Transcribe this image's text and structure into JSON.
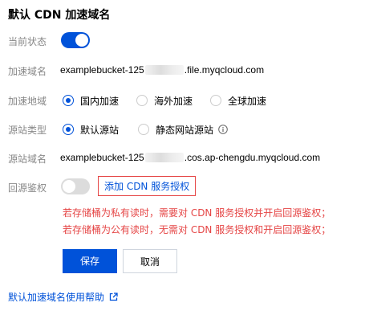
{
  "title": "默认 CDN 加速域名",
  "current_status": {
    "label": "当前状态",
    "enabled": true
  },
  "domain": {
    "label": "加速域名",
    "prefix": "examplebucket-125",
    "suffix": ".file.myqcloud.com"
  },
  "region": {
    "label": "加速地域",
    "options": [
      "国内加速",
      "海外加速",
      "全球加速"
    ],
    "selected": "国内加速"
  },
  "origin_type": {
    "label": "源站类型",
    "options": [
      "默认源站",
      "静态网站源站"
    ],
    "selected": "默认源站"
  },
  "origin_domain": {
    "label": "源站域名",
    "prefix": "examplebucket-125",
    "suffix": ".cos.ap-chengdu.myqcloud.com"
  },
  "back_to_origin_auth": {
    "label": "回源鉴权",
    "enabled": false,
    "link_text": "添加 CDN 服务授权"
  },
  "warnings": [
    "若存储桶为私有读时，需要对 CDN 服务授权并开启回源鉴权；",
    "若存储桶为公有读时，无需对 CDN 服务授权和开启回源鉴权；"
  ],
  "buttons": {
    "save": "保存",
    "cancel": "取消"
  },
  "help_link": "默认加速域名使用帮助",
  "colors": {
    "primary": "#0052d9",
    "warning": "#e54545",
    "label": "#888888"
  },
  "icons": {
    "info": "info-icon",
    "external": "external-link-icon"
  }
}
